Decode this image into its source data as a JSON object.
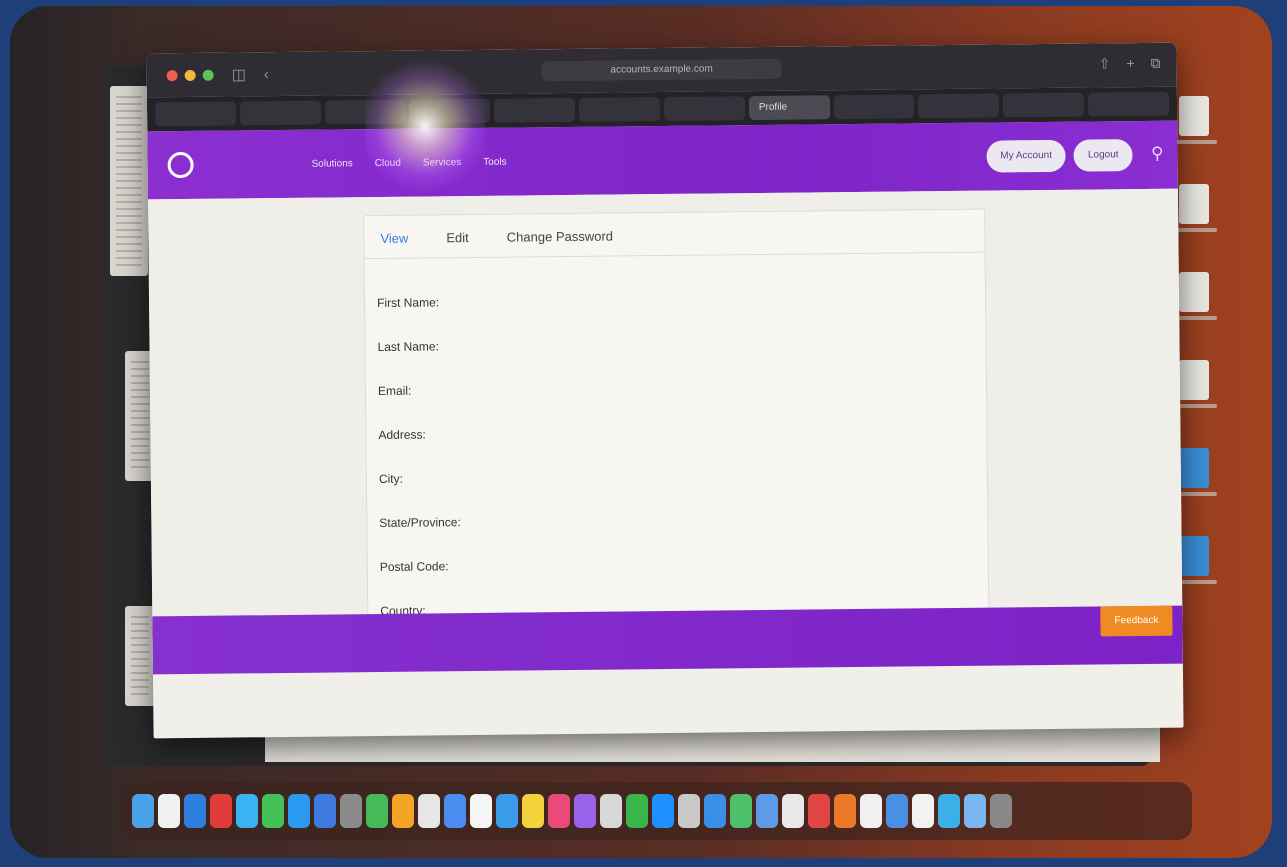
{
  "browser": {
    "address": "accounts.example.com",
    "tabs": [
      "",
      "",
      "",
      "",
      "",
      "",
      "",
      "Profile",
      "",
      "",
      "",
      ""
    ],
    "active_tab_index": 7
  },
  "site": {
    "logo_line1": "",
    "logo_line2": "",
    "nav_links": [
      "Solutions",
      "Cloud",
      "Services",
      "Tools"
    ],
    "account_button": "My Account",
    "login_button": "Logout",
    "feedback_button": "Feedback"
  },
  "profile": {
    "tabs": [
      "View",
      "Edit",
      "Change Password"
    ],
    "active_tab": 0,
    "fields": [
      {
        "label": "First Name:",
        "value": ""
      },
      {
        "label": "Last Name:",
        "value": ""
      },
      {
        "label": "Email:",
        "value": ""
      },
      {
        "label": "Address:",
        "value": ""
      },
      {
        "label": "City:",
        "value": ""
      },
      {
        "label": "State/Province:",
        "value": ""
      },
      {
        "label": "Postal Code:",
        "value": ""
      },
      {
        "label": "Country:",
        "value": ""
      }
    ]
  },
  "background_doc": {
    "line1": "",
    "line2": ""
  },
  "dock": {
    "icon_colors": [
      "#4aa3e8",
      "#f1f1f1",
      "#2d7fe0",
      "#e23b3b",
      "#3ab3f2",
      "#45c15a",
      "#2c9af0",
      "#3f7ae0",
      "#8b8b8b",
      "#48b957",
      "#f2a623",
      "#e6e6e6",
      "#4b8cf0",
      "#f5f5f5",
      "#3a9ce8",
      "#f4d23c",
      "#e84a7a",
      "#9a62e8",
      "#d7d7d7",
      "#39b54a",
      "#1e90ff",
      "#c9c9c9",
      "#3a8ee6",
      "#4fbf6b",
      "#5e9ae8",
      "#e8e8e8",
      "#e04646",
      "#ea7a2a",
      "#f0f0f0",
      "#4a90e2",
      "#f2f2f2",
      "#3cb0e6",
      "#7ab7f0",
      "#888888"
    ]
  }
}
